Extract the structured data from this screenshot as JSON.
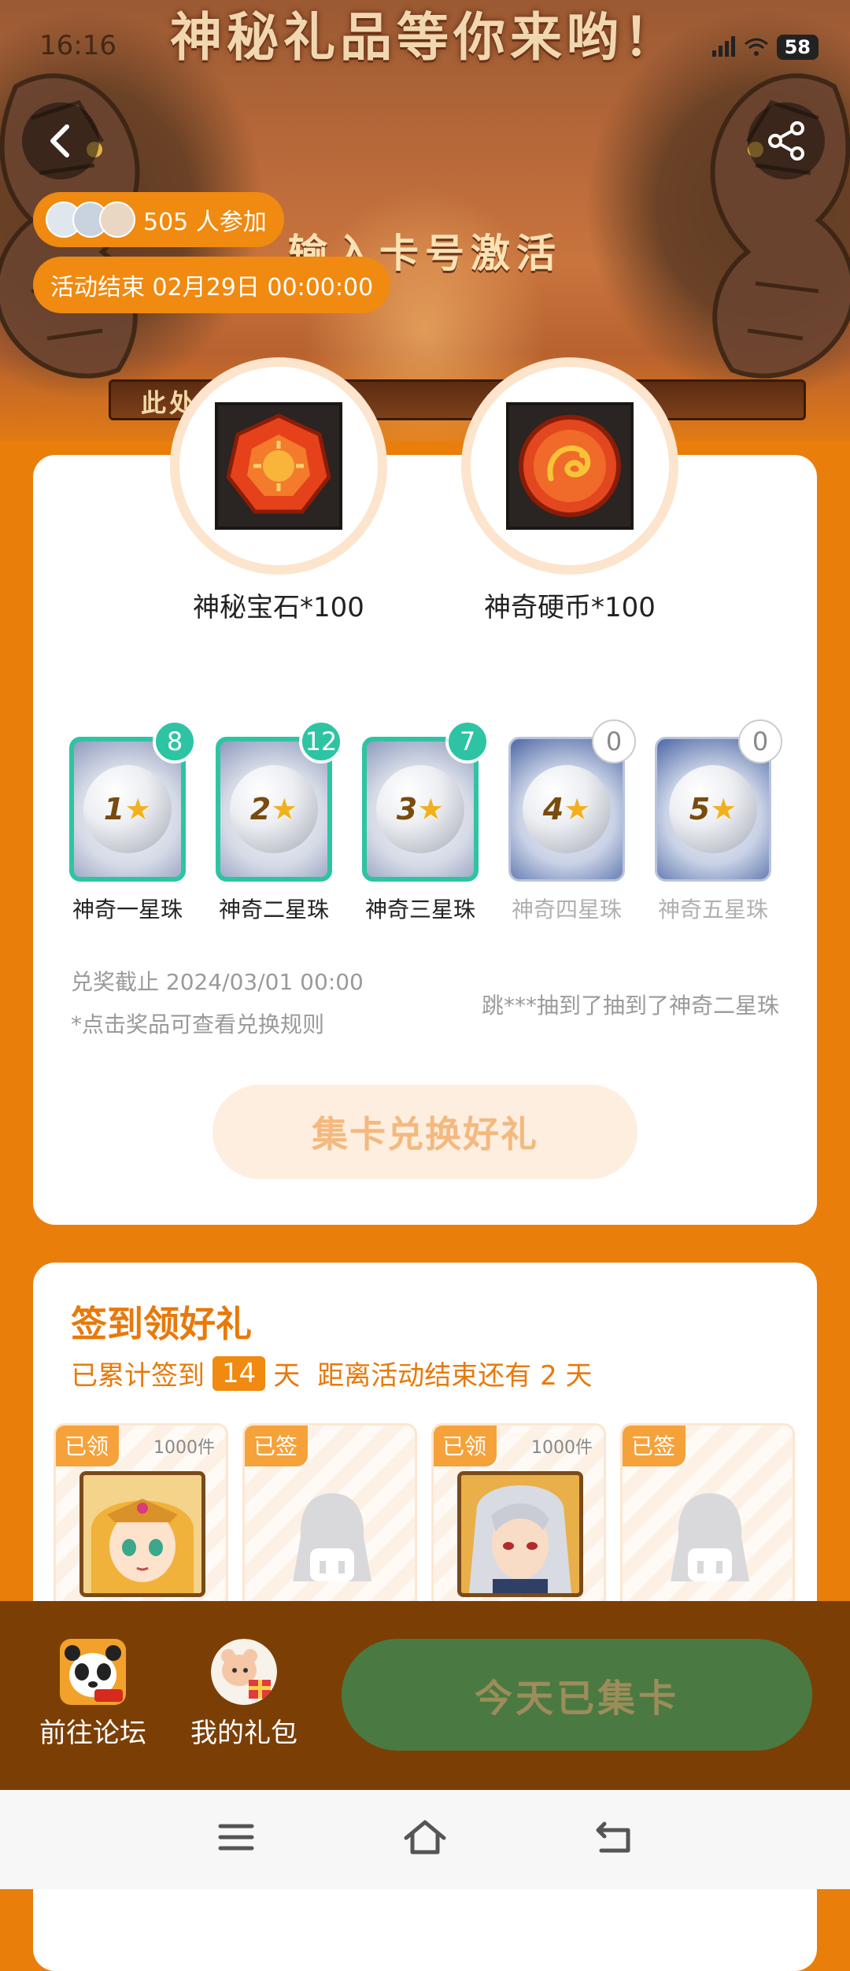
{
  "status_bar": {
    "time": "16:16",
    "battery": "58"
  },
  "banner": {
    "title": "神秘礼品等你来哟！",
    "subtitle": "输入卡号激活",
    "strip_text": "此处"
  },
  "participants": {
    "count_text": "505 人参加"
  },
  "activity_end": {
    "text": "活动结束 02月29日 00:00:00"
  },
  "prizes": [
    {
      "label": "神秘宝石*100",
      "icon": "gem-icon"
    },
    {
      "label": "神奇硬币*100",
      "icon": "dragon-coin-icon"
    }
  ],
  "collect_cards": [
    {
      "label": "神奇一星珠",
      "count": "8",
      "stars": "1",
      "owned": true
    },
    {
      "label": "神奇二星珠",
      "count": "12",
      "stars": "2",
      "owned": true
    },
    {
      "label": "神奇三星珠",
      "count": "7",
      "stars": "3",
      "owned": true
    },
    {
      "label": "神奇四星珠",
      "count": "0",
      "stars": "4",
      "owned": false
    },
    {
      "label": "神奇五星珠",
      "count": "0",
      "stars": "5",
      "owned": false
    }
  ],
  "redeem": {
    "deadline": "兑奖截止 2024/03/01 00:00",
    "rule_hint": "*点击奖品可查看兑换规则",
    "ticker": "跳***抽到了抽到了神奇二星珠",
    "button_label": "集卡兑换好礼"
  },
  "checkin": {
    "title": "签到领好礼",
    "prefix": "已累计签到",
    "days": "14",
    "unit": "天",
    "remaining": "距离活动结束还有 2 天",
    "tiles": [
      {
        "tag": "已领",
        "qty": "1000件",
        "type": "portrait-girl"
      },
      {
        "tag": "已签",
        "qty": "",
        "type": "placeholder"
      },
      {
        "tag": "已领",
        "qty": "1000件",
        "type": "portrait-man"
      },
      {
        "tag": "已签",
        "qty": "",
        "type": "placeholder"
      }
    ]
  },
  "bottom_bar": {
    "forum_label": "前往论坛",
    "gift_label": "我的礼包",
    "collect_button": "今天已集卡"
  },
  "colors": {
    "accent": "#ea7e0a",
    "teal": "#2ec4a3",
    "collect_btn": "#4a7a42",
    "bottom_bar": "#7b3f06"
  }
}
